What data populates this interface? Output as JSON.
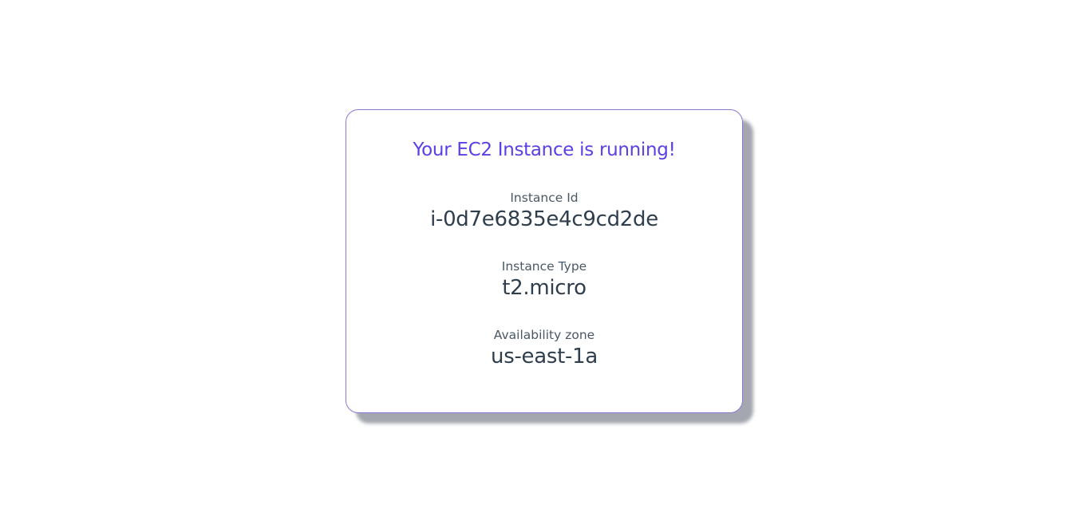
{
  "card": {
    "title": "Your EC2 Instance is running!",
    "fields": [
      {
        "label": "Instance Id",
        "value": "i-0d7e6835e4c9cd2de"
      },
      {
        "label": "Instance Type",
        "value": "t2.micro"
      },
      {
        "label": "Availability zone",
        "value": "us-east-1a"
      }
    ]
  },
  "colors": {
    "title": "#5b3fe6",
    "border": "#8a7ad6",
    "label": "#4a5866",
    "value": "#2e3e4c"
  }
}
